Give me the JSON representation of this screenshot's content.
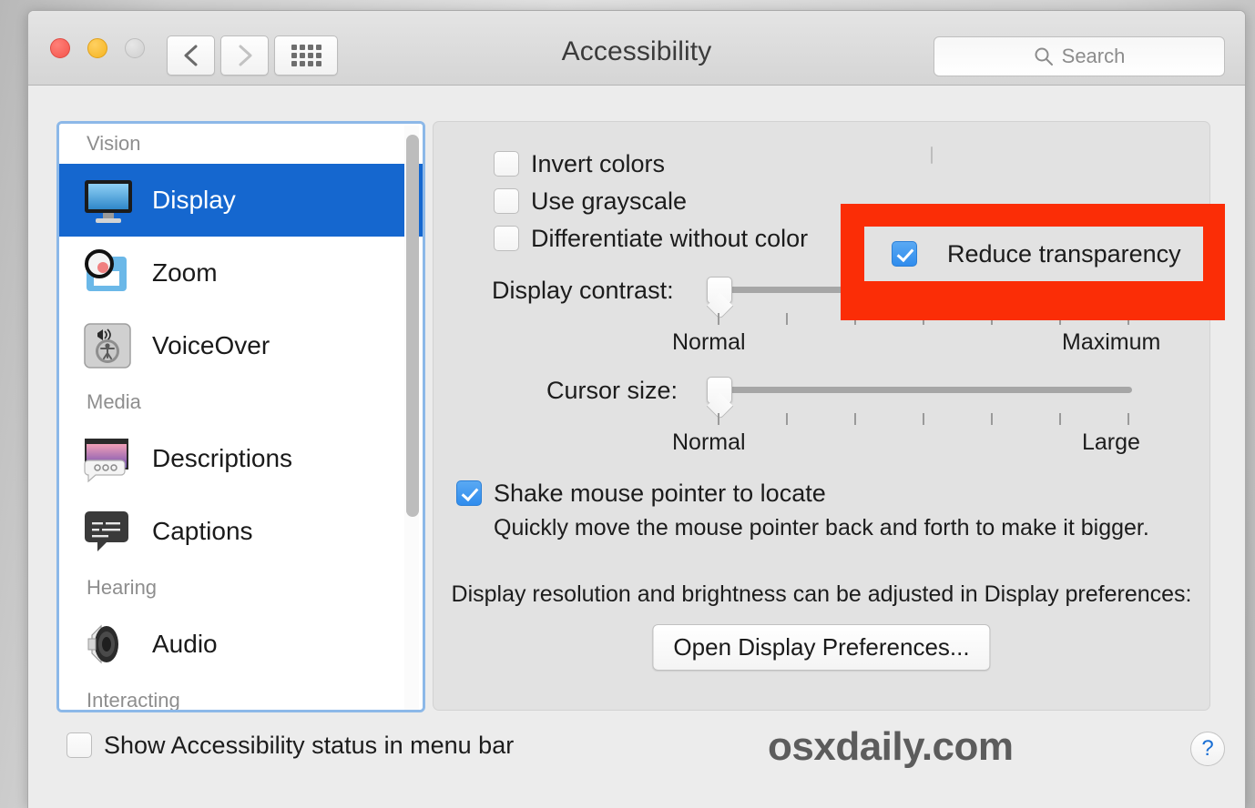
{
  "window": {
    "title": "Accessibility",
    "traffic_lights": [
      "close-red",
      "minimize-yellow",
      "zoom-gray-disabled"
    ],
    "nav": {
      "back": "back-chevron",
      "forward": "forward-chevron",
      "grid": "show-all-grid"
    },
    "search": {
      "placeholder": "Search",
      "value": "",
      "icon": "search-icon"
    }
  },
  "sidebar": {
    "groups": [
      {
        "title": "Vision"
      },
      {
        "title": "Media"
      },
      {
        "title": "Hearing"
      },
      {
        "title": "Interacting"
      }
    ],
    "items": [
      {
        "label": "Display",
        "icon": "display-monitor-icon",
        "selected": true
      },
      {
        "label": "Zoom",
        "icon": "zoom-magnifier-icon",
        "selected": false
      },
      {
        "label": "VoiceOver",
        "icon": "voiceover-icon",
        "selected": false
      },
      {
        "label": "Descriptions",
        "icon": "descriptions-icon",
        "selected": false
      },
      {
        "label": "Captions",
        "icon": "captions-icon",
        "selected": false
      },
      {
        "label": "Audio",
        "icon": "audio-speaker-icon",
        "selected": false
      }
    ]
  },
  "main": {
    "checkboxes_left": [
      {
        "label": "Invert colors",
        "checked": false
      },
      {
        "label": "Use grayscale",
        "checked": false
      },
      {
        "label": "Differentiate without color",
        "checked": false
      }
    ],
    "highlighted_checkbox": {
      "label": "Reduce transparency",
      "checked": true
    },
    "sliders": [
      {
        "label": "Display contrast:",
        "min_label": "Normal",
        "max_label": "Maximum",
        "value_position_percent": 0,
        "tick_count": 7
      },
      {
        "label": "Cursor size:",
        "min_label": "Normal",
        "max_label": "Large",
        "value_position_percent": 0,
        "tick_count": 7
      }
    ],
    "shake": {
      "label": "Shake mouse pointer to locate",
      "checked": true,
      "description": "Quickly move the mouse pointer back and forth to make it bigger."
    },
    "note": "Display resolution and brightness can be adjusted in Display preferences:",
    "open_display_preferences_label": "Open Display Preferences..."
  },
  "bottom": {
    "show_status_label": "Show Accessibility status in menu bar",
    "show_status_checked": false,
    "watermark": "osxdaily.com",
    "help_label": "?"
  },
  "colors": {
    "selection_blue": "#1567cf",
    "checkbox_blue": "#2f8ced",
    "highlight_red": "#fb2d06",
    "focus_ring_blue": "#8cb8e8"
  }
}
